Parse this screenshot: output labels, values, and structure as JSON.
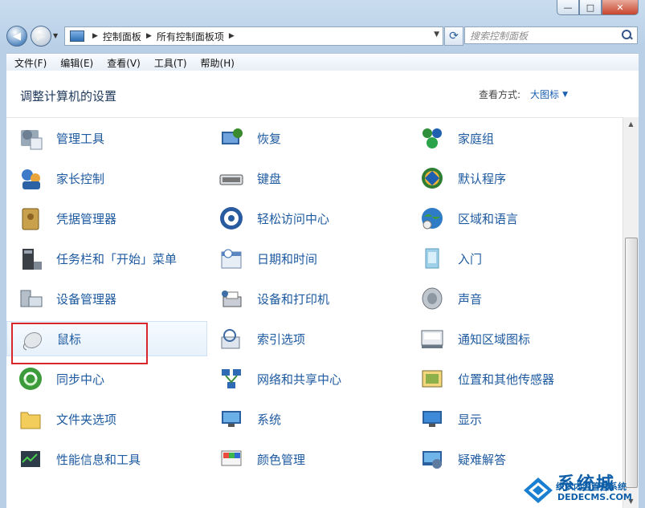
{
  "window": {
    "buttons": {
      "minimize": "—",
      "maximize": "□",
      "close": "✕"
    }
  },
  "address": {
    "crumbs": [
      "控制面板",
      "所有控制面板项"
    ],
    "search_placeholder": "搜索控制面板"
  },
  "menu": [
    "文件(F)",
    "编辑(E)",
    "查看(V)",
    "工具(T)",
    "帮助(H)"
  ],
  "header": {
    "title": "调整计算机的设置",
    "view_by_label": "查看方式:",
    "view_by_value": "大图标"
  },
  "items": [
    {
      "label": "管理工具",
      "icon": "admin-tools-icon"
    },
    {
      "label": "恢复",
      "icon": "recovery-icon"
    },
    {
      "label": "家庭组",
      "icon": "homegroup-icon"
    },
    {
      "label": "家长控制",
      "icon": "parental-controls-icon"
    },
    {
      "label": "键盘",
      "icon": "keyboard-icon"
    },
    {
      "label": "默认程序",
      "icon": "default-programs-icon"
    },
    {
      "label": "凭据管理器",
      "icon": "credential-manager-icon"
    },
    {
      "label": "轻松访问中心",
      "icon": "ease-of-access-icon"
    },
    {
      "label": "区域和语言",
      "icon": "region-language-icon"
    },
    {
      "label": "任务栏和「开始」菜单",
      "icon": "taskbar-icon"
    },
    {
      "label": "日期和时间",
      "icon": "date-time-icon"
    },
    {
      "label": "入门",
      "icon": "getting-started-icon"
    },
    {
      "label": "设备管理器",
      "icon": "device-manager-icon"
    },
    {
      "label": "设备和打印机",
      "icon": "devices-printers-icon"
    },
    {
      "label": "声音",
      "icon": "sound-icon"
    },
    {
      "label": "鼠标",
      "icon": "mouse-icon"
    },
    {
      "label": "索引选项",
      "icon": "indexing-icon"
    },
    {
      "label": "通知区域图标",
      "icon": "notification-area-icon"
    },
    {
      "label": "同步中心",
      "icon": "sync-center-icon"
    },
    {
      "label": "网络和共享中心",
      "icon": "network-sharing-icon"
    },
    {
      "label": "位置和其他传感器",
      "icon": "location-sensors-icon"
    },
    {
      "label": "文件夹选项",
      "icon": "folder-options-icon"
    },
    {
      "label": "系统",
      "icon": "system-icon"
    },
    {
      "label": "显示",
      "icon": "display-icon"
    },
    {
      "label": "性能信息和工具",
      "icon": "performance-icon"
    },
    {
      "label": "颜色管理",
      "icon": "color-management-icon"
    },
    {
      "label": "疑难解答",
      "icon": "troubleshooting-icon"
    }
  ],
  "watermark": {
    "brand": "系统城",
    "tag": "织梦内容管理系统",
    "url": "DEDECMS.COM"
  }
}
